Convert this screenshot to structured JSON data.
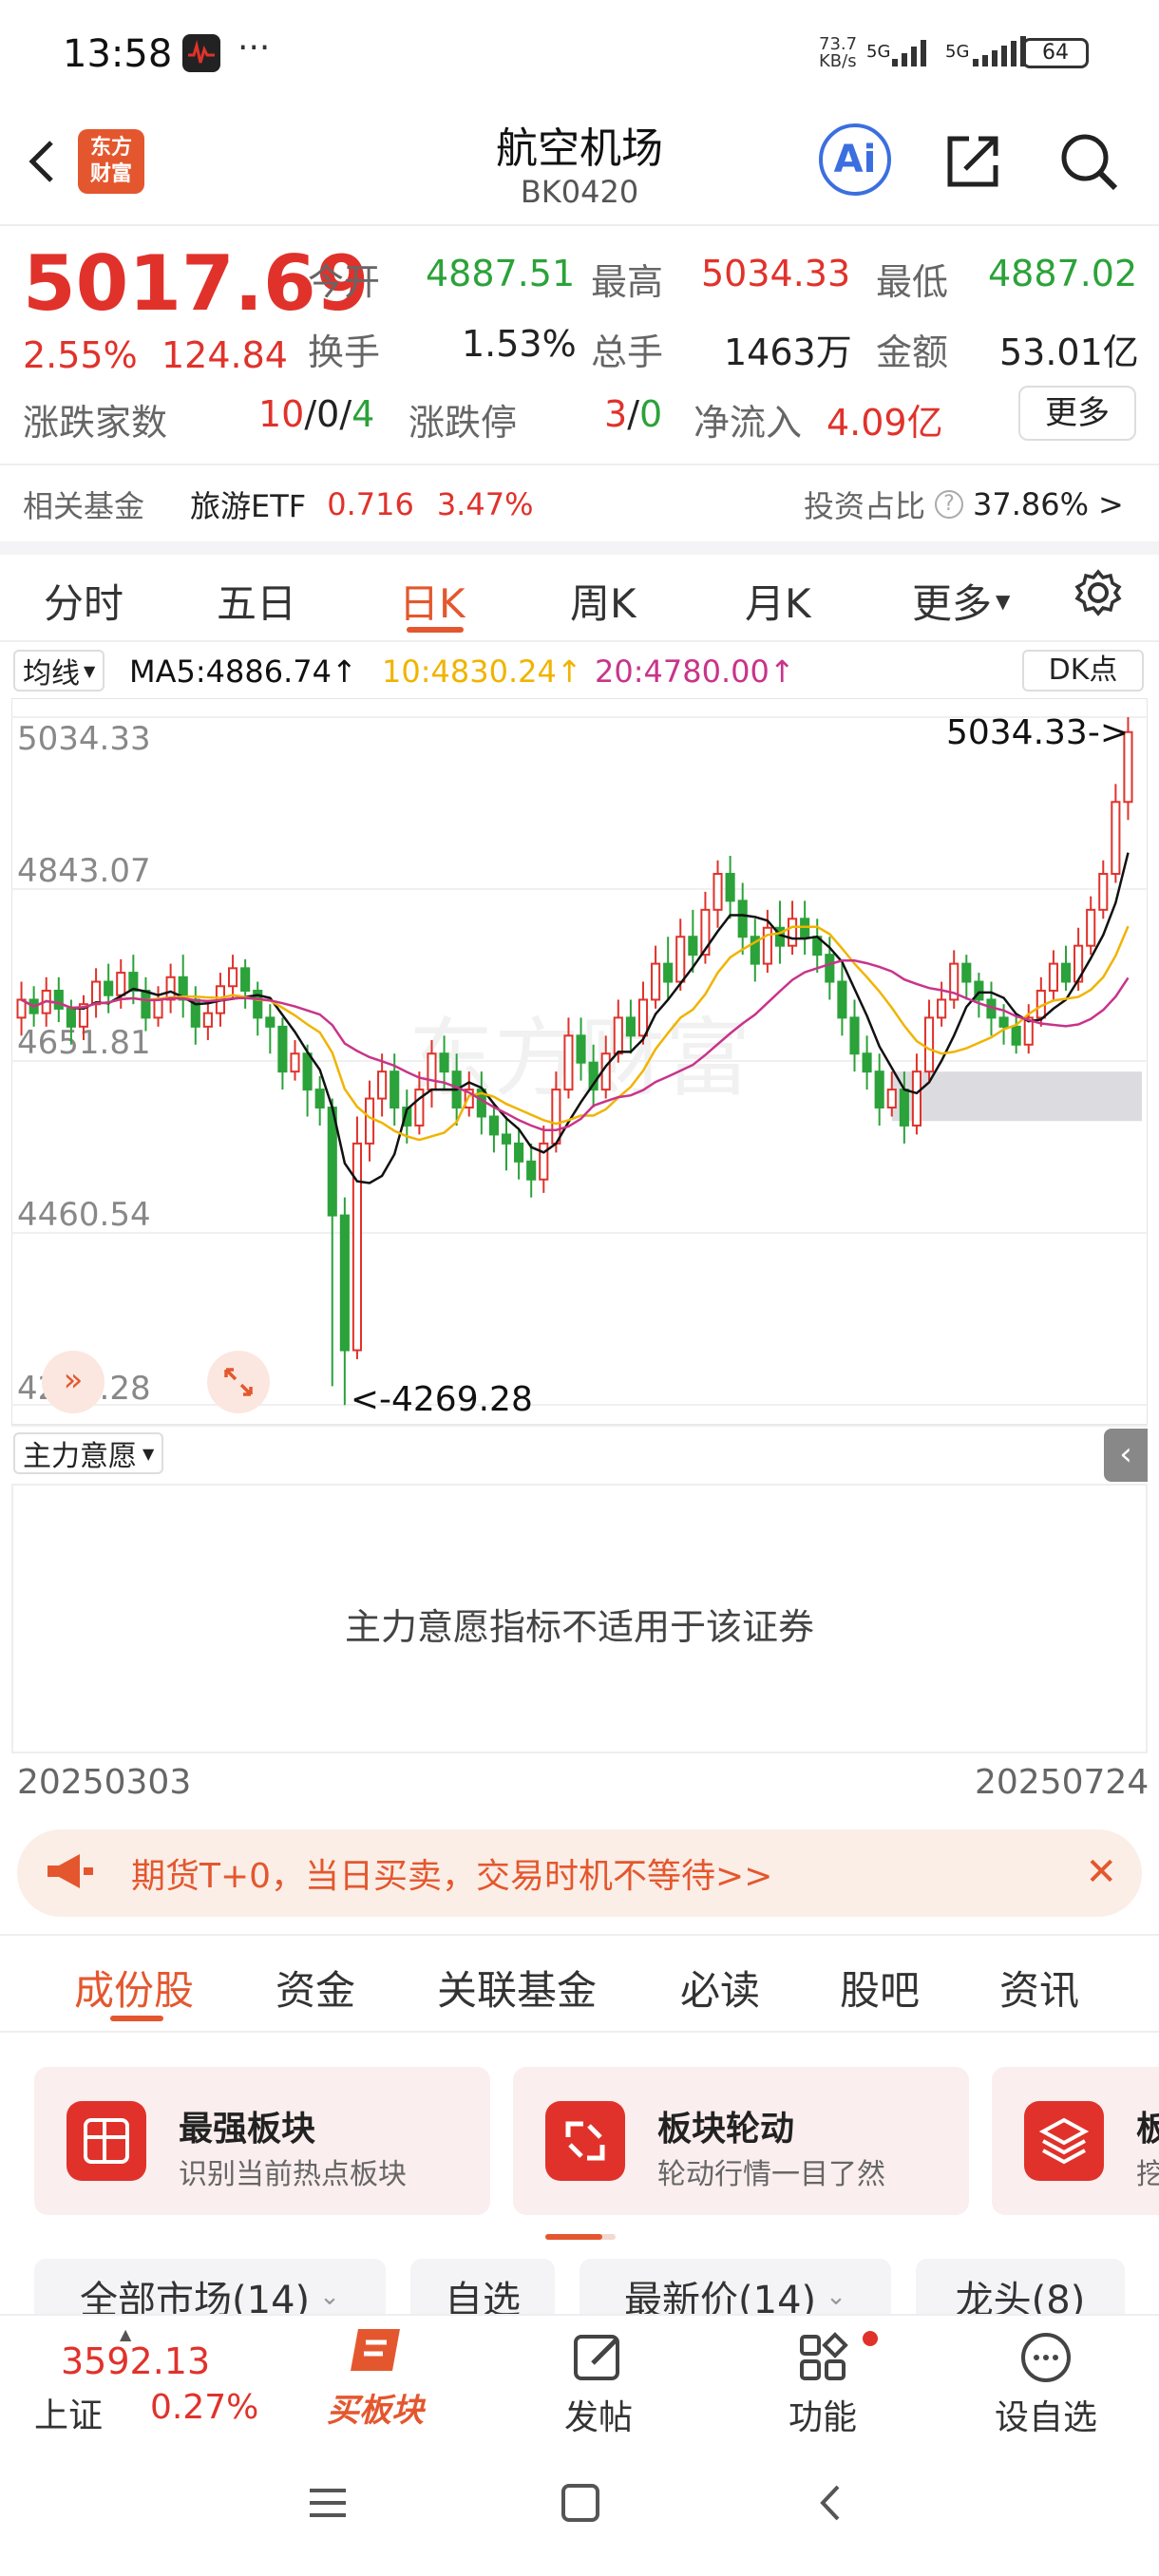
{
  "status_bar": {
    "time": "13:58",
    "dots": "···",
    "net_speed_top": "73.7",
    "net_speed_bottom": "KB/s",
    "sig1": "5G",
    "sig2": "5G",
    "battery": "64"
  },
  "header": {
    "title": "航空机场",
    "code": "BK0420",
    "logo_text_1": "东方",
    "logo_text_2": "财富",
    "ai_label": "Ai"
  },
  "quote": {
    "price": "5017.69",
    "change_pct": "2.55%",
    "change_abs": "124.84",
    "open_label": "今开",
    "open": "4887.51",
    "high_label": "最高",
    "high": "5034.33",
    "low_label": "最低",
    "low": "4887.02",
    "turnover_label": "换手",
    "turnover": "1.53%",
    "volume_label": "总手",
    "volume": "1463万",
    "amount_label": "金额",
    "amount": "53.01亿",
    "breadth_label": "涨跌家数",
    "breadth_up": "10",
    "breadth_flat": "0",
    "breadth_down": "4",
    "limit_label": "涨跌停",
    "limit_up": "3",
    "limit_down": "0",
    "netflow_label": "净流入",
    "netflow": "4.09亿",
    "more_button": "更多"
  },
  "fund_row": {
    "label": "相关基金",
    "fund_name": "旅游ETF",
    "fund_price": "0.716",
    "fund_pct": "3.47%",
    "invest_label": "投资占比",
    "invest_value": "37.86%",
    "chevron": ">"
  },
  "chart_tabs": [
    "分时",
    "五日",
    "日K",
    "周K",
    "月K",
    "更多"
  ],
  "active_tab_index": 2,
  "ma_bar": {
    "selector": "均线",
    "ma5": "MA5:4886.74",
    "ma10": "10:4830.24",
    "ma20": "20:4780.00",
    "dk_button": "DK点"
  },
  "colors": {
    "up": "#e0322b",
    "down": "#2ba23a",
    "ma5": "#111111",
    "ma10": "#f0b400",
    "ma20": "#c8348a",
    "accent": "#e4572e"
  },
  "chart_data": {
    "type": "candlestick",
    "y_ticks": [
      "5034.33",
      "4843.07",
      "4651.81",
      "4460.54",
      "4269.28"
    ],
    "ylim": [
      4269.28,
      5034.33
    ],
    "max_label": "5034.33->",
    "min_label": "<-4269.28",
    "start_date": "20250303",
    "end_date": "20250724",
    "candles": [
      [
        4700,
        4720,
        4680,
        4740
      ],
      [
        4720,
        4705,
        4690,
        4735
      ],
      [
        4705,
        4730,
        4690,
        4745
      ],
      [
        4730,
        4710,
        4695,
        4745
      ],
      [
        4710,
        4690,
        4670,
        4720
      ],
      [
        4690,
        4715,
        4675,
        4725
      ],
      [
        4715,
        4740,
        4700,
        4755
      ],
      [
        4740,
        4725,
        4705,
        4760
      ],
      [
        4725,
        4750,
        4710,
        4765
      ],
      [
        4750,
        4730,
        4715,
        4770
      ],
      [
        4730,
        4700,
        4685,
        4745
      ],
      [
        4700,
        4720,
        4690,
        4735
      ],
      [
        4720,
        4745,
        4705,
        4760
      ],
      [
        4745,
        4720,
        4700,
        4770
      ],
      [
        4720,
        4690,
        4670,
        4735
      ],
      [
        4690,
        4705,
        4675,
        4715
      ],
      [
        4705,
        4735,
        4690,
        4750
      ],
      [
        4735,
        4755,
        4720,
        4770
      ],
      [
        4755,
        4730,
        4710,
        4765
      ],
      [
        4730,
        4700,
        4680,
        4740
      ],
      [
        4700,
        4690,
        4660,
        4715
      ],
      [
        4690,
        4640,
        4620,
        4700
      ],
      [
        4640,
        4660,
        4630,
        4675
      ],
      [
        4660,
        4620,
        4590,
        4670
      ],
      [
        4620,
        4600,
        4580,
        4635
      ],
      [
        4600,
        4480,
        4290,
        4610
      ],
      [
        4480,
        4330,
        4269,
        4500
      ],
      [
        4330,
        4560,
        4320,
        4590
      ],
      [
        4560,
        4610,
        4540,
        4630
      ],
      [
        4610,
        4640,
        4590,
        4660
      ],
      [
        4640,
        4600,
        4580,
        4660
      ],
      [
        4600,
        4580,
        4560,
        4620
      ],
      [
        4580,
        4620,
        4570,
        4640
      ],
      [
        4620,
        4660,
        4600,
        4675
      ],
      [
        4660,
        4640,
        4620,
        4680
      ],
      [
        4640,
        4600,
        4580,
        4660
      ],
      [
        4600,
        4620,
        4590,
        4640
      ],
      [
        4620,
        4590,
        4570,
        4640
      ],
      [
        4590,
        4570,
        4550,
        4605
      ],
      [
        4570,
        4560,
        4530,
        4590
      ],
      [
        4560,
        4540,
        4520,
        4575
      ],
      [
        4540,
        4520,
        4500,
        4560
      ],
      [
        4520,
        4560,
        4505,
        4580
      ],
      [
        4560,
        4620,
        4550,
        4640
      ],
      [
        4620,
        4680,
        4610,
        4700
      ],
      [
        4680,
        4650,
        4630,
        4700
      ],
      [
        4650,
        4620,
        4600,
        4670
      ],
      [
        4620,
        4660,
        4610,
        4680
      ],
      [
        4660,
        4700,
        4650,
        4720
      ],
      [
        4700,
        4680,
        4660,
        4720
      ],
      [
        4680,
        4720,
        4670,
        4740
      ],
      [
        4720,
        4760,
        4710,
        4780
      ],
      [
        4760,
        4740,
        4720,
        4790
      ],
      [
        4740,
        4790,
        4730,
        4810
      ],
      [
        4790,
        4770,
        4750,
        4820
      ],
      [
        4770,
        4820,
        4760,
        4840
      ],
      [
        4820,
        4860,
        4800,
        4875
      ],
      [
        4860,
        4830,
        4810,
        4880
      ],
      [
        4830,
        4790,
        4770,
        4850
      ],
      [
        4790,
        4760,
        4740,
        4810
      ],
      [
        4760,
        4800,
        4750,
        4820
      ],
      [
        4800,
        4780,
        4760,
        4830
      ],
      [
        4780,
        4810,
        4770,
        4830
      ],
      [
        4810,
        4790,
        4770,
        4830
      ],
      [
        4790,
        4770,
        4750,
        4810
      ],
      [
        4770,
        4740,
        4720,
        4790
      ],
      [
        4740,
        4700,
        4680,
        4760
      ],
      [
        4700,
        4660,
        4640,
        4720
      ],
      [
        4660,
        4640,
        4620,
        4680
      ],
      [
        4640,
        4600,
        4580,
        4660
      ],
      [
        4600,
        4620,
        4590,
        4640
      ],
      [
        4620,
        4580,
        4560,
        4640
      ],
      [
        4580,
        4640,
        4570,
        4660
      ],
      [
        4640,
        4700,
        4630,
        4720
      ],
      [
        4700,
        4720,
        4690,
        4740
      ],
      [
        4720,
        4760,
        4710,
        4775
      ],
      [
        4760,
        4740,
        4720,
        4770
      ],
      [
        4740,
        4720,
        4700,
        4750
      ],
      [
        4720,
        4700,
        4680,
        4740
      ],
      [
        4700,
        4690,
        4670,
        4715
      ],
      [
        4690,
        4670,
        4660,
        4705
      ],
      [
        4670,
        4700,
        4660,
        4715
      ],
      [
        4700,
        4730,
        4690,
        4745
      ],
      [
        4730,
        4760,
        4720,
        4775
      ],
      [
        4760,
        4740,
        4730,
        4780
      ],
      [
        4740,
        4780,
        4730,
        4800
      ],
      [
        4780,
        4820,
        4770,
        4835
      ],
      [
        4820,
        4860,
        4810,
        4875
      ],
      [
        4860,
        4940,
        4850,
        4960
      ],
      [
        4940,
        5017.69,
        4920,
        5034.33
      ]
    ]
  },
  "indicator": {
    "selector": "主力意愿",
    "message": "主力意愿指标不适用于该证券"
  },
  "promo": {
    "text": "期货T+0，当日买卖，交易时机不等待>>"
  },
  "section_tabs": [
    "成份股",
    "资金",
    "关联基金",
    "必读",
    "股吧",
    "资讯"
  ],
  "active_section_index": 0,
  "feature_cards": [
    {
      "title": "最强板块",
      "subtitle": "识别当前热点板块"
    },
    {
      "title": "板块轮动",
      "subtitle": "轮动行情一目了然"
    },
    {
      "title": "板",
      "subtitle": "挖"
    }
  ],
  "filters": [
    "全部市场(14)",
    "自选",
    "最新价(14)",
    "龙头(8)"
  ],
  "bottom_nav": {
    "index_value": "3592.13",
    "index_name": "上证",
    "index_pct": "0.27%",
    "items": [
      "买板块",
      "发帖",
      "功能",
      "设自选"
    ]
  }
}
